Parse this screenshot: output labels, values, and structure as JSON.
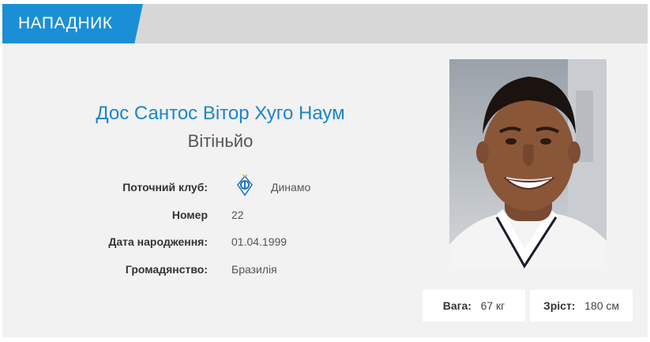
{
  "header": {
    "position": "НАПАДНИК"
  },
  "player": {
    "full_name": "Дос Сантос Вітор Хуго Наум",
    "nickname": "Вітіньйо"
  },
  "info": {
    "club_label": "Поточний клуб:",
    "club_value": "Динамо",
    "club_logo_icon": "dynamo-kyiv-logo-icon",
    "number_label": "Номер",
    "number_value": "22",
    "birth_label": "Дата народження:",
    "birth_value": "01.04.1999",
    "citizenship_label": "Громадянство:",
    "citizenship_value": "Бразилія"
  },
  "stats": {
    "weight_label": "Вага:",
    "weight_value": "67 кг",
    "height_label": "Зріст:",
    "height_value": "180 см"
  },
  "colors": {
    "accent": "#1b8fd6",
    "name_color": "#1b85c8",
    "header_bg": "#d7d7d7",
    "card_bg": "#f2f2f2"
  }
}
